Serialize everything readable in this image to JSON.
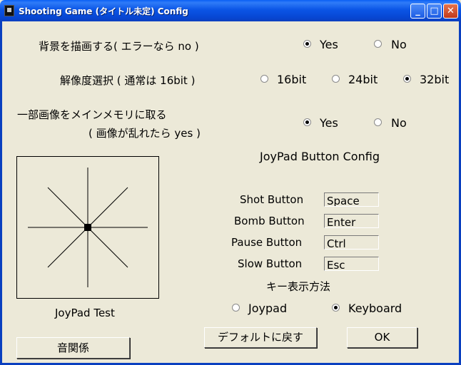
{
  "window": {
    "title": "Shooting Game (タイトル未定) Config",
    "minimize_glyph": "_",
    "maximize_glyph": "□",
    "close_glyph": "✕"
  },
  "background": {
    "label": "背景を描画する( エラーなら no )",
    "options": [
      "Yes",
      "No"
    ],
    "selected": "Yes"
  },
  "resolution": {
    "label": "解像度選択 ( 通常は 16bit )",
    "options": [
      "16bit",
      "24bit",
      "32bit"
    ],
    "selected": "32bit"
  },
  "main_memory": {
    "label_line1": "一部画像をメインメモリに取る",
    "label_line2": "( 画像が乱れたら yes )",
    "options": [
      "Yes",
      "No"
    ],
    "selected": "Yes"
  },
  "joypad_config": {
    "title": "JoyPad Button Config",
    "buttons": [
      {
        "label": "Shot Button",
        "value": "Space"
      },
      {
        "label": "Bomb Button",
        "value": "Enter"
      },
      {
        "label": "Pause Button",
        "value": "Ctrl"
      },
      {
        "label": "Slow Button",
        "value": "Esc"
      }
    ]
  },
  "key_display": {
    "label": "キー表示方法",
    "options": [
      "Joypad",
      "Keyboard"
    ],
    "selected": "Keyboard"
  },
  "joypad_test": {
    "label": "JoyPad Test"
  },
  "actions": {
    "sound_label": "音関係",
    "default_label": "デフォルトに戻す",
    "ok_label": "OK"
  },
  "colors": {
    "titlebar": "#0a55e6",
    "dialog_bg": "#ece9d8"
  }
}
